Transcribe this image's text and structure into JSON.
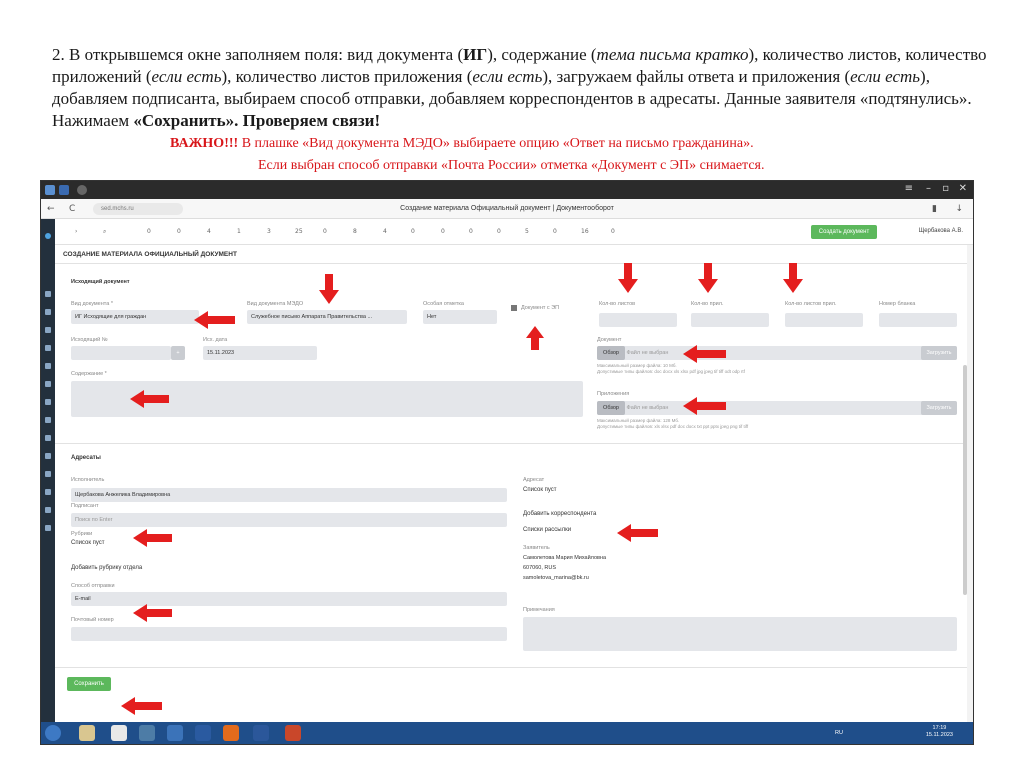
{
  "slide": {
    "para_p1": "2. В открывшемся окне заполняем поля: вид документа (",
    "para_ig": "ИГ",
    "para_p2": "), содержание (",
    "para_i1": "тема письма кратко",
    "para_p3": "), количество листов, количество приложений (",
    "para_i2": "если есть",
    "para_p4": "), количество листов приложения (",
    "para_i3": "если есть",
    "para_p5": "), загружаем файлы ответа и приложения (",
    "para_i4": "если есть",
    "para_p6": "), добавляем подписанта, выбираем способ отправки, добавляем корреспондентов в адресаты. Данные заявителя «подтянулись». Нажимаем ",
    "para_b1": "«Сохранить». Проверяем связи!",
    "warn1_bold": "ВАЖНО!!!",
    "warn1_rest": " В плашке «Вид документа МЭДО» выбираете опцию «Ответ на письмо гражданина».",
    "warn2": "Если выбран способ отправки «Почта России» отметка «Документ с ЭП» снимается."
  },
  "browser": {
    "url": "sed.mchs.ru",
    "page_title": "Создание материала Официальный документ | Документооборот",
    "back": "←",
    "reload": "C"
  },
  "toolbar": {
    "items": [
      "0",
      "0",
      "4",
      "1",
      "3",
      "25",
      "0",
      "8",
      "4",
      "0",
      "0",
      "0",
      "0",
      "5",
      "0",
      "16",
      "0"
    ],
    "create_button": "Создать документ",
    "user": "Щербакова А.В."
  },
  "form": {
    "header": "СОЗДАНИЕ МАТЕРИАЛА ОФИЦИАЛЬНЫЙ ДОКУМЕНТ",
    "outgoing_tab": "Исходящий документ",
    "doc_type_label": "Вид документа *",
    "doc_type_value": "ИГ Исходящие для граждан",
    "medo_label": "Вид документа МЭДО",
    "medo_value": "Служебное письмо Аппарата Правительства ...",
    "special_label": "Особая отметка",
    "special_value": "Нет",
    "ep_label": "Документ с ЭП",
    "sheets_label": "Кол-во листов",
    "appx_label": "Кол-во прил.",
    "appx_sheets_label": "Кол-во листов прил.",
    "form_no_label": "Номер бланка",
    "out_no_label": "Исходящий №",
    "out_date_label": "Исх. дата",
    "out_date_value": "15.11.2023",
    "content_label": "Содержание *",
    "document_label": "Документ",
    "browse": "Обзор",
    "file_placeholder": "Файл не выбран",
    "upload": "Загрузить",
    "doc_hint1": "Максимальный размер файла: 10 Мб.",
    "doc_hint2": "Допустимые типы файлов: doc docx xls xlsx pdf jpg jpeg tif tiff odt odp rtf",
    "appendix_label": "Приложения",
    "appx_hint1": "Максимальный размер файла: 128 Мб.",
    "appx_hint2": "Допустимые типы файлов: xls xlsx pdf doc docx txt ppt pptx jpeg png tif tiff",
    "addressees": "Адресаты",
    "executor_label": "Исполнитель",
    "executor_value": "Щербакова Анжелика Владимировна",
    "signer_label": "Подписант",
    "signer_placeholder": "Поиск по Enter",
    "rubrics_label": "Рубрики",
    "list_empty": "Список пуст",
    "add_rubric": "Добавить рубрику отдела",
    "method_label": "Способ отправки",
    "method_value": "E-mail",
    "postal_label": "Почтовый номер",
    "addressee_label": "Адресат",
    "addressee_empty": "Список пуст",
    "add_correspondent": "Добавить корреспондента",
    "mailing_lists": "Списки рассылки",
    "applicant_label": "Заявитель",
    "applicant_name": "Самолетова Мария Михайловна",
    "applicant_addr": "607060, RUS",
    "applicant_email": "samoletova_marina@bk.ru",
    "notes_label": "Примечания",
    "save": "Сохранить"
  },
  "taskbar": {
    "time": "17:19",
    "date": "15.11.2023",
    "lang": "RU"
  },
  "colors": {
    "arrow": "#e41e1e",
    "warn": "#d8161a",
    "green": "#5cb85c",
    "taskbar": "#1f4e8a"
  }
}
